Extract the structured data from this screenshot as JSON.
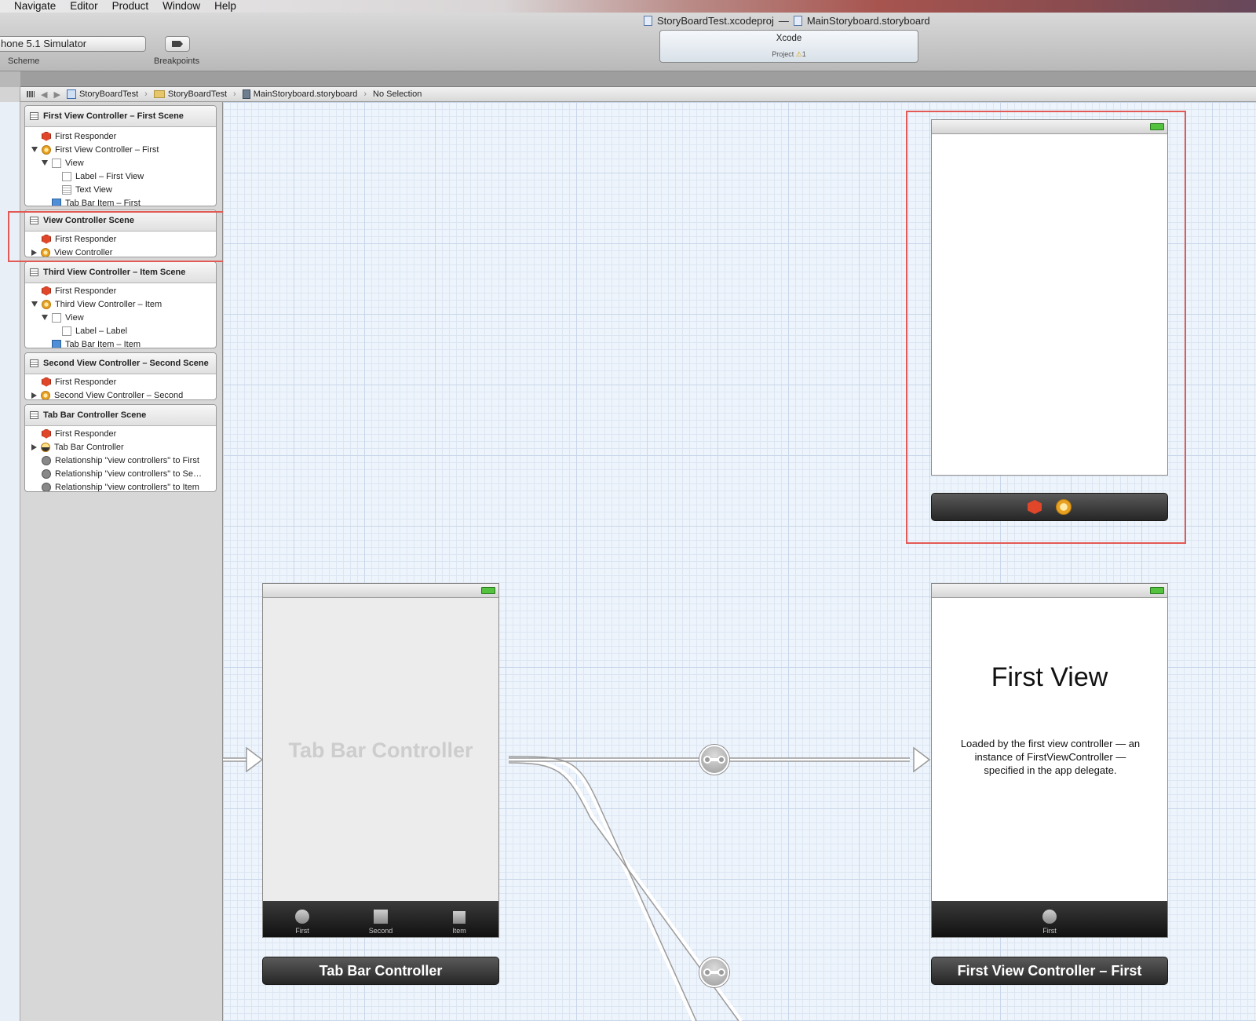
{
  "menubar": {
    "items": [
      "Navigate",
      "Editor",
      "Product",
      "Window",
      "Help"
    ]
  },
  "toolbar": {
    "scheme_value": "hone 5.1 Simulator",
    "scheme_label": "Scheme",
    "breakpoints_label": "Breakpoints",
    "window_title_project": "StoryBoardTest.xcodeproj",
    "window_title_sep": "—",
    "window_title_file": "MainStoryboard.storyboard",
    "activity_title": "Xcode",
    "activity_project": "Project",
    "activity_warning_count": "1"
  },
  "jumpbar": {
    "crumbs": [
      "StoryBoardTest",
      "StoryBoardTest",
      "MainStoryboard.storyboard",
      "No Selection"
    ]
  },
  "outline": {
    "scenes": [
      {
        "title": "First View Controller – First Scene",
        "rows": [
          "First Responder",
          "First View Controller – First",
          "View",
          "Label – First View",
          "Text View",
          "Tab Bar Item – First"
        ]
      },
      {
        "title": "View Controller Scene",
        "rows": [
          "First Responder",
          "View Controller"
        ]
      },
      {
        "title": "Third View Controller – Item Scene",
        "rows": [
          "First Responder",
          "Third View Controller – Item",
          "View",
          "Label – Label",
          "Tab Bar Item – Item"
        ]
      },
      {
        "title": "Second View Controller – Second Scene",
        "rows": [
          "First Responder",
          "Second View Controller – Second"
        ]
      },
      {
        "title": "Tab Bar Controller Scene",
        "rows": [
          "First Responder",
          "Tab Bar Controller",
          "Relationship \"view controllers\" to First",
          "Relationship \"view controllers\" to Se…",
          "Relationship \"view controllers\" to Item"
        ]
      }
    ]
  },
  "canvas": {
    "tab_bar_controller": {
      "placeholder": "Tab Bar Controller",
      "tabs": [
        "First",
        "Second",
        "Item"
      ],
      "dock_title": "Tab Bar Controller"
    },
    "first_view_controller": {
      "heading": "First View",
      "body": "Loaded by the first view controller — an instance of FirstViewController — specified in the app delegate.",
      "tabs": [
        "First"
      ],
      "dock_title": "First View Controller – First"
    }
  },
  "colors": {
    "highlight": "#e25a55",
    "canvas_bg": "#eef4fb"
  },
  "icons": {
    "first_responder": "cube-icon",
    "view_controller": "view-controller-icon",
    "tab_bar_controller": "tab-bar-controller-icon",
    "view": "view-icon",
    "label": "label-icon",
    "text_view": "text-view-icon",
    "tab_bar_item": "star-icon",
    "relationship": "relationship-icon"
  }
}
